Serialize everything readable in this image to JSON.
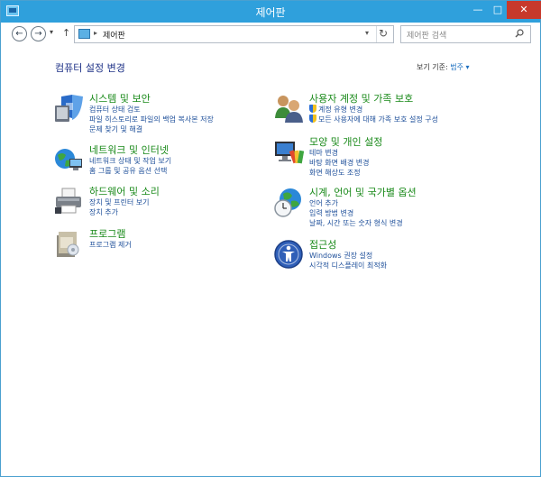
{
  "window": {
    "title": "제어판"
  },
  "titlebar": {
    "minimize": "—",
    "maximize": "□",
    "close": "✕"
  },
  "nav": {
    "back": "←",
    "forward": "→",
    "recent": "▾",
    "up": "↑"
  },
  "address": {
    "separator": "▸",
    "path": "제어판",
    "dropdown": "▾",
    "refresh": "↻"
  },
  "search": {
    "placeholder": "제어판 검색"
  },
  "main": {
    "title": "컴퓨터 설정 변경",
    "view_by": {
      "label": "보기 기준:",
      "value": "범주 ▾"
    }
  },
  "categories": {
    "system": {
      "title": "시스템 및 보안",
      "links": [
        "컴퓨터 상태 검토",
        "파일 히스토리로 파일의 백업 복사본 저장",
        "문제 찾기 및 해결"
      ]
    },
    "network": {
      "title": "네트워크 및 인터넷",
      "links": [
        "네트워크 상태 및 작업 보기",
        "홈 그룹 및 공유 옵션 선택"
      ]
    },
    "hardware": {
      "title": "하드웨어 및 소리",
      "links": [
        "장치 및 프린터 보기",
        "장치 추가"
      ]
    },
    "programs": {
      "title": "프로그램",
      "links": [
        "프로그램 제거"
      ]
    },
    "users": {
      "title": "사용자 계정 및 가족 보호",
      "links": [
        "계정 유형 변경",
        "모든 사용자에 대해 가족 보호 설정 구성"
      ]
    },
    "appearance": {
      "title": "모양 및 개인 설정",
      "links": [
        "테마 변경",
        "바탕 화면 배경 변경",
        "화면 해상도 조정"
      ]
    },
    "clock": {
      "title": "시계, 언어 및 국가별 옵션",
      "links": [
        "언어 추가",
        "입력 방법 변경",
        "날짜, 시간 또는 숫자 형식 변경"
      ]
    },
    "ease": {
      "title": "접근성",
      "links": [
        "Windows 권장 설정",
        "시각적 디스플레이 최적화"
      ]
    }
  },
  "colors": {
    "accent": "#2fa0dc",
    "category_title": "#1a8a1a",
    "link": "#1e4f9a",
    "close": "#c7392c"
  }
}
